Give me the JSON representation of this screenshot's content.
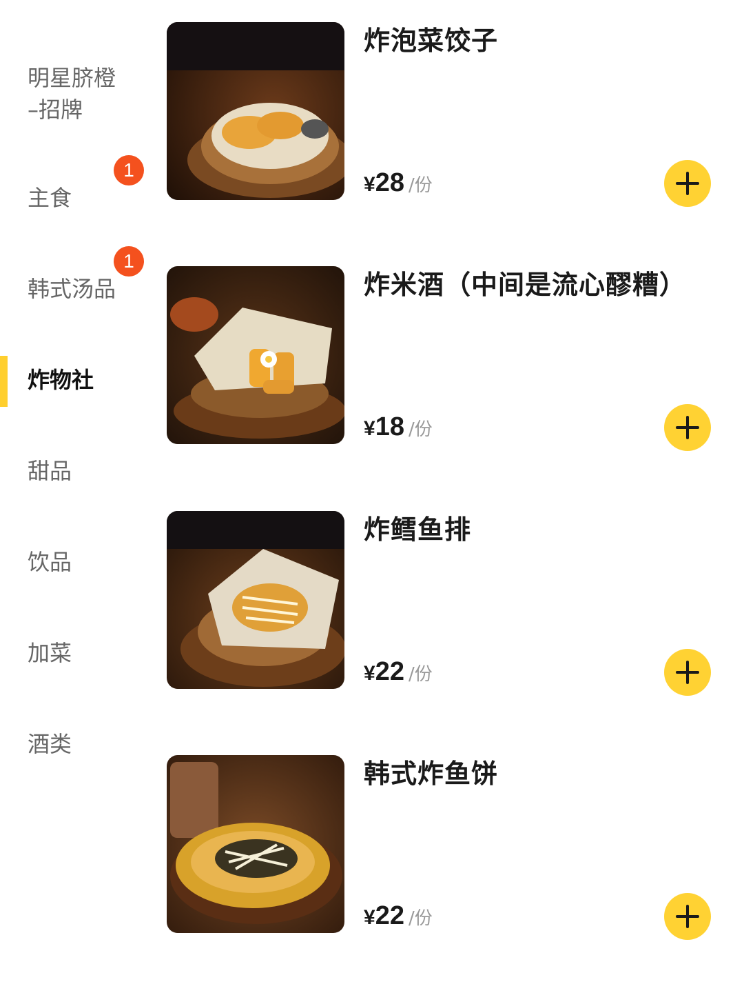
{
  "sidebar": {
    "categories": [
      {
        "label": "明星脐橙\n–招牌",
        "badge": ""
      },
      {
        "label": "主食",
        "badge": "1"
      },
      {
        "label": "韩式汤品",
        "badge": "1"
      },
      {
        "label": "炸物社",
        "badge": "",
        "active": true
      },
      {
        "label": "甜品",
        "badge": ""
      },
      {
        "label": "饮品",
        "badge": ""
      },
      {
        "label": "加菜",
        "badge": ""
      },
      {
        "label": "酒类",
        "badge": ""
      }
    ],
    "accent_color": "#FFCF2E",
    "badge_color": "#F4511E"
  },
  "items": [
    {
      "name": "炸泡菜饺子",
      "currency": "¥",
      "price": "28",
      "unit": "/份",
      "image": "fried-kimchi-dumplings-photo"
    },
    {
      "name": "炸米酒（中间是流心醪糟）",
      "currency": "¥",
      "price": "18",
      "unit": "/份",
      "image": "fried-rice-wine-photo"
    },
    {
      "name": "炸鳕鱼排",
      "currency": "¥",
      "price": "22",
      "unit": "/份",
      "image": "fried-cod-fillet-photo"
    },
    {
      "name": "韩式炸鱼饼",
      "currency": "¥",
      "price": "22",
      "unit": "/份",
      "image": "korean-fried-fishcake-photo"
    }
  ],
  "add_button_color": "#FFD233",
  "add_icon": "plus-icon"
}
